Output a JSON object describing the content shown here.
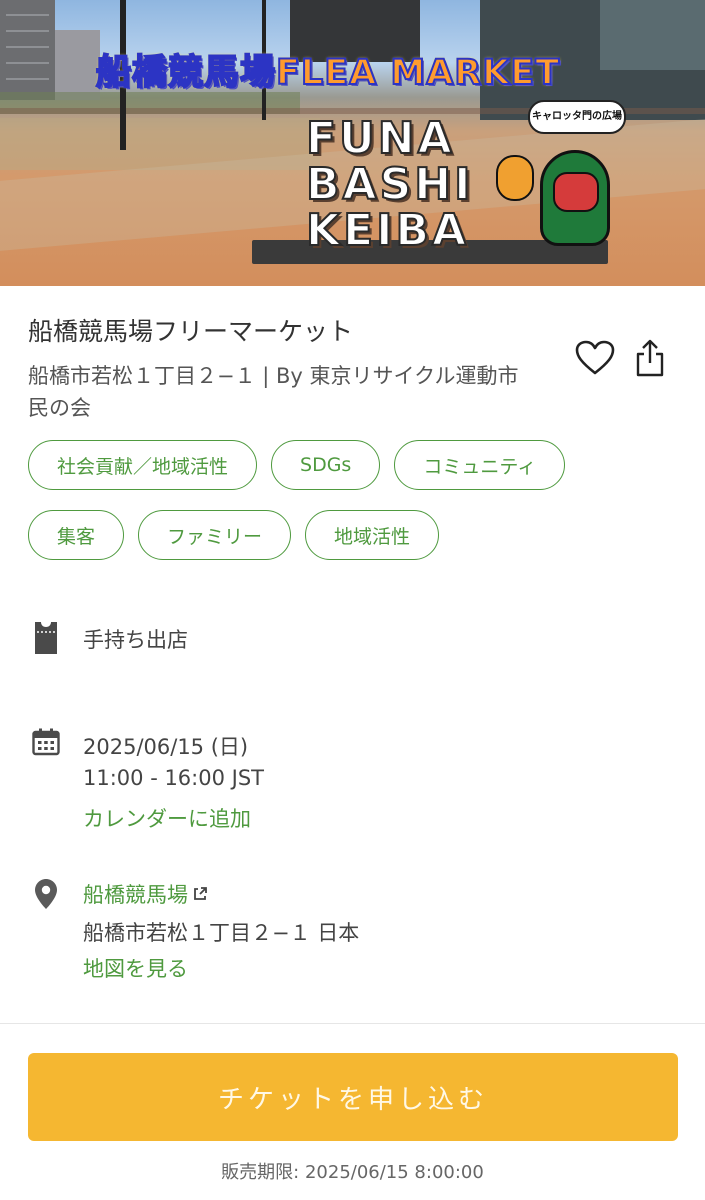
{
  "hero": {
    "banner_title": "船橋競馬場FLEA MARKET",
    "sign_line1": "FUNA",
    "sign_line2": "BASHI",
    "sign_line3": "KEIBA",
    "bubble_text": "キャロッタ門の広場"
  },
  "event": {
    "title": "船橋競馬場フリーマーケット",
    "subtitle": "船橋市若松１丁目２−１ | By 東京リサイクル運動市民の会"
  },
  "actions": {
    "favorite_icon": "heart-outline-icon",
    "share_icon": "share-icon"
  },
  "tags": [
    [
      "社会貢献／地域活性",
      "SDGs",
      "コミュニティ"
    ],
    [
      "集客",
      "ファミリー",
      "地域活性"
    ]
  ],
  "ticket": {
    "icon": "ticket-icon",
    "label": "手持ち出店"
  },
  "schedule": {
    "icon": "calendar-icon",
    "date": "2025/06/15 (日)",
    "time": "11:00 - 16:00 JST",
    "add_calendar": "カレンダーに追加"
  },
  "location": {
    "icon": "location-pin-icon",
    "venue": "船橋競馬場",
    "address": "船橋市若松１丁目２−１ 日本",
    "map_link": "地図を見る"
  },
  "cta": {
    "label": "チケットを申し込む",
    "deadline": "販売期限: 2025/06/15 8:00:00"
  },
  "colors": {
    "accent_green": "#4f9a3f",
    "cta_yellow": "#f5b731"
  }
}
